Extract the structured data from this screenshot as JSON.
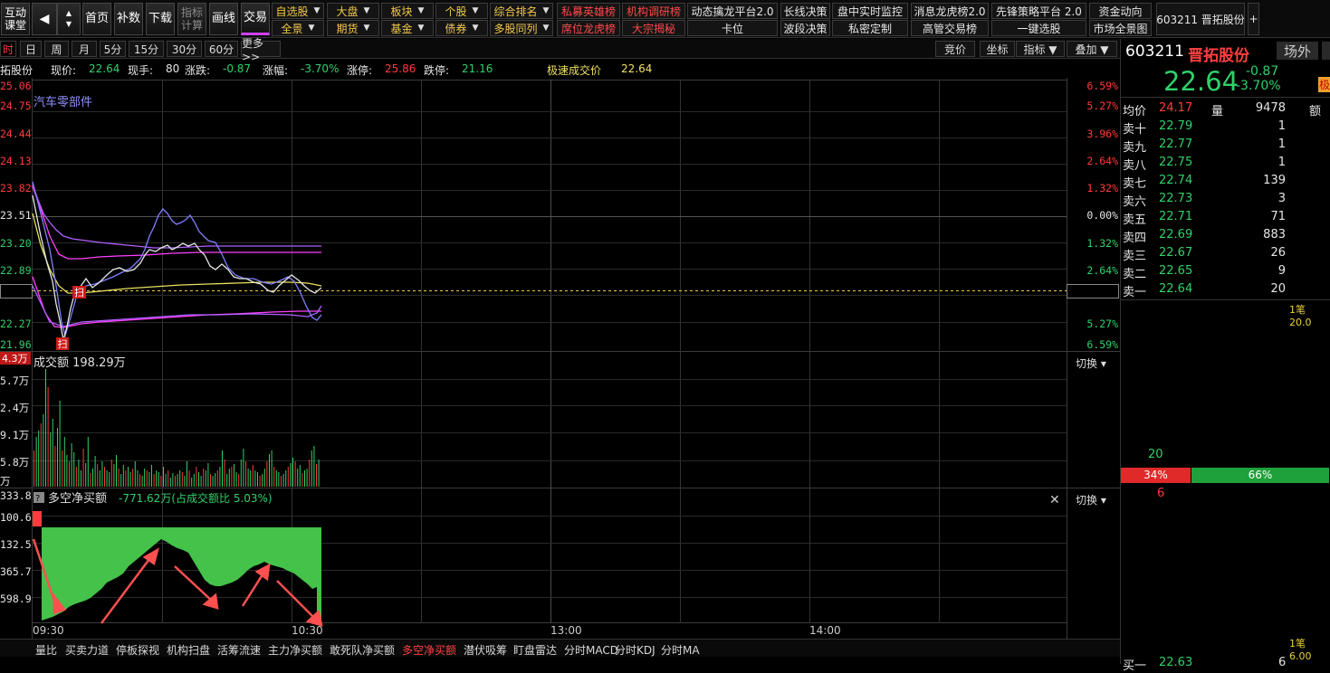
{
  "toolbar": {
    "left_big": {
      "line1": "互动",
      "line2": "课堂"
    },
    "big_buttons": [
      "首页",
      "补数",
      "下载"
    ],
    "indicator_calc": {
      "line1": "指标",
      "line2": "计算"
    },
    "draw": "画线",
    "trade": "交易",
    "row1": [
      {
        "label": "自选股",
        "color": "y",
        "dropdown": true
      },
      {
        "label": "大盘",
        "color": "y",
        "dropdown": true
      },
      {
        "label": "板块",
        "color": "y",
        "dropdown": true
      },
      {
        "label": "个股",
        "color": "y",
        "dropdown": true
      },
      {
        "label": "综合排名",
        "color": "y",
        "dropdown": true
      },
      {
        "label": "私募英雄榜",
        "color": "r",
        "dropdown": false
      },
      {
        "label": "机构调研榜",
        "color": "r",
        "dropdown": false
      },
      {
        "label": "动态擒龙平台2.0",
        "color": "w",
        "dropdown": false
      },
      {
        "label": "长线决策",
        "color": "w",
        "dropdown": false
      },
      {
        "label": "盘中实时监控",
        "color": "w",
        "dropdown": false
      },
      {
        "label": "消息龙虎榜2.0",
        "color": "w",
        "dropdown": false
      },
      {
        "label": "先锋策略平台 2.0",
        "color": "w",
        "dropdown": false
      },
      {
        "label": "资金动向",
        "color": "w",
        "dropdown": false
      }
    ],
    "row2": [
      {
        "label": "全景",
        "color": "y",
        "dropdown": true
      },
      {
        "label": "期货",
        "color": "y",
        "dropdown": true
      },
      {
        "label": "基金",
        "color": "y",
        "dropdown": true
      },
      {
        "label": "债券",
        "color": "y",
        "dropdown": true
      },
      {
        "label": "多股同列",
        "color": "y",
        "dropdown": true
      },
      {
        "label": "席位龙虎榜",
        "color": "r",
        "dropdown": false
      },
      {
        "label": "大宗揭秘",
        "color": "r",
        "dropdown": false
      },
      {
        "label": "卡位",
        "color": "w",
        "dropdown": false
      },
      {
        "label": "波段决策",
        "color": "w",
        "dropdown": false
      },
      {
        "label": "私密定制",
        "color": "w",
        "dropdown": false
      },
      {
        "label": "高管交易榜",
        "color": "w",
        "dropdown": false
      },
      {
        "label": "一键选股",
        "color": "w",
        "dropdown": false
      },
      {
        "label": "市场全景图",
        "color": "w",
        "dropdown": false
      }
    ],
    "tab_stock": "603211 晋拓股份",
    "tab_add": "+"
  },
  "periods": [
    "时",
    "日",
    "周",
    "月",
    "5分",
    "15分",
    "30分",
    "60分",
    "更多>>"
  ],
  "right_tools": [
    "竞价",
    "坐标",
    "指标 ▼",
    "叠加 ▼"
  ],
  "info": {
    "name": "拓股份",
    "price_label": "现价:",
    "price": "22.64",
    "hand_label": "现手:",
    "hand": "80",
    "change_label": "涨跌:",
    "change": "-0.87",
    "pct_label": "涨幅:",
    "pct": "-3.70%",
    "limit_up_label": "涨停:",
    "limit_up": "25.86",
    "limit_down_label": "跌停:",
    "limit_down": "21.16",
    "fast_label": "极速成交价",
    "fast": "22.64"
  },
  "price_chart": {
    "sector_label": "汽车零部件",
    "left_ticks": [
      "25.06",
      "24.75",
      "24.44",
      "24.13",
      "23.82",
      "23.51",
      "23.20",
      "22.89",
      "22.64",
      "22.27",
      "21.96"
    ],
    "right_ticks": [
      "6.59%",
      "5.27%",
      "3.96%",
      "2.64%",
      "1.32%",
      "0.00%",
      "1.32%",
      "2.64%",
      "-3.70%",
      "5.27%",
      "6.59%"
    ],
    "scan_mark": "扫"
  },
  "volume_chart": {
    "title": "成交额 198.29万",
    "top_tag": "4.3万",
    "ticks": [
      "5.7万",
      "2.4万",
      "9.1万",
      "5.8万",
      "万"
    ],
    "switch": "切换 ▾"
  },
  "netbuy_chart": {
    "help": "?",
    "title": "多空净买额",
    "value": "-771.62万(占成交额比 5.03%)",
    "close": "✕",
    "switch": "切换 ▾",
    "ticks": [
      "333.8",
      "100.6",
      "132.5",
      "365.7",
      "598.9"
    ]
  },
  "time_axis": [
    "09:30",
    "10:30",
    "13:00",
    "14:00"
  ],
  "bottom_tabs": [
    "量比",
    "买卖力道",
    "停板探视",
    "机构扫盘",
    "活筹流速",
    "主力净买额",
    "敢死队净买额",
    "多空净买额",
    "潜伏吸筹",
    "盯盘雷达",
    "分时MACD",
    "分时KDJ",
    "分时MA"
  ],
  "bottom_tab_active": "多空净买额",
  "quote": {
    "code": "603211",
    "name": "晋拓股份",
    "venue": "场外",
    "price": "22.64",
    "change": "-0.87",
    "pct": "-3.70%",
    "tag": "极",
    "avg_label": "均价",
    "avg": "24.17",
    "vol_label": "量",
    "vol": "9478",
    "amt_label": "额",
    "asks": [
      {
        "label": "卖十",
        "price": "22.79",
        "vol": "1"
      },
      {
        "label": "卖九",
        "price": "22.77",
        "vol": "1"
      },
      {
        "label": "卖八",
        "price": "22.75",
        "vol": "1"
      },
      {
        "label": "卖七",
        "price": "22.74",
        "vol": "139"
      },
      {
        "label": "卖六",
        "price": "22.73",
        "vol": "3"
      },
      {
        "label": "卖五",
        "price": "22.71",
        "vol": "71"
      },
      {
        "label": "卖四",
        "price": "22.69",
        "vol": "883"
      },
      {
        "label": "卖三",
        "price": "22.67",
        "vol": "26"
      },
      {
        "label": "卖二",
        "price": "22.65",
        "vol": "9"
      },
      {
        "label": "卖一",
        "price": "22.64",
        "vol": "20"
      }
    ],
    "stroke_top": "1笔 20.0",
    "green_count": "20",
    "red_count": "6",
    "ratio_red": "34%",
    "ratio_green": "66%",
    "ratio_red_value": 0.34,
    "stroke_bottom": "1笔 6.00",
    "bid_label": "买一",
    "bid": "22.63",
    "bid_vol": "6"
  },
  "colors": {
    "red": "#ff3b3b",
    "green": "#2fd16a",
    "yellow": "#f0e060",
    "purple": "#b060ff",
    "magenta": "#ff40ff",
    "blue_line": "#8080ff"
  }
}
